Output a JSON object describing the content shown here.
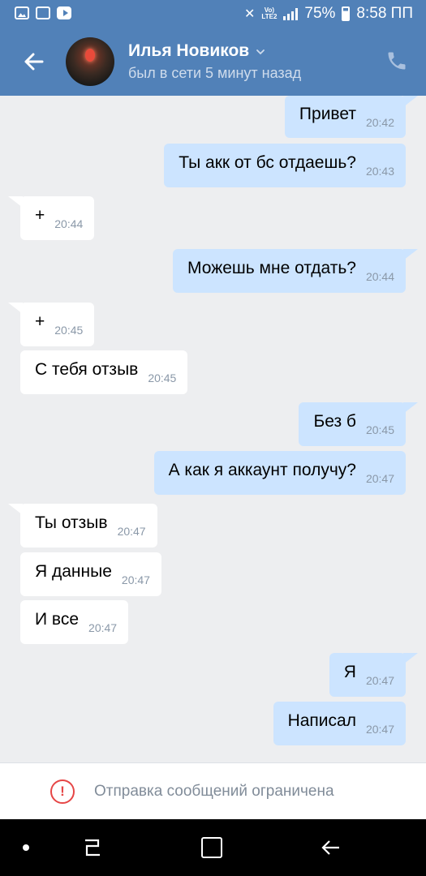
{
  "status_bar": {
    "volte_top": "Vo)",
    "volte_bottom": "LTE2",
    "battery": "75%",
    "time": "8:58 ПП"
  },
  "header": {
    "contact_name": "Илья Новиков",
    "last_seen": "был в сети 5 минут назад"
  },
  "messages": [
    {
      "dir": "out",
      "text": "Привет",
      "time": "20:42"
    },
    {
      "dir": "out",
      "text": "Ты акк от бс отдаешь?",
      "time": "20:43"
    },
    {
      "dir": "in",
      "text": "+",
      "time": "20:44"
    },
    {
      "dir": "out",
      "text": "Можешь мне отдать?",
      "time": "20:44"
    },
    {
      "dir": "in",
      "text": "+",
      "time": "20:45"
    },
    {
      "dir": "in",
      "text": "С тебя отзыв",
      "time": "20:45"
    },
    {
      "dir": "out",
      "text": "Без б",
      "time": "20:45"
    },
    {
      "dir": "out",
      "text": "А как я аккаунт получу?",
      "time": "20:47"
    },
    {
      "dir": "in",
      "text": "Ты отзыв",
      "time": "20:47"
    },
    {
      "dir": "in",
      "text": "Я данные",
      "time": "20:47"
    },
    {
      "dir": "in",
      "text": "И все",
      "time": "20:47"
    },
    {
      "dir": "out",
      "text": "Я",
      "time": "20:47"
    },
    {
      "dir": "out",
      "text": "Написал",
      "time": "20:47"
    }
  ],
  "restriction": {
    "icon": "!",
    "text": "Отправка сообщений ограничена"
  },
  "colors": {
    "header_bg": "#5181b8",
    "outgoing_bubble": "#cce4ff",
    "incoming_bubble": "#ffffff",
    "chat_bg": "#edeef0",
    "warning": "#e64646"
  }
}
